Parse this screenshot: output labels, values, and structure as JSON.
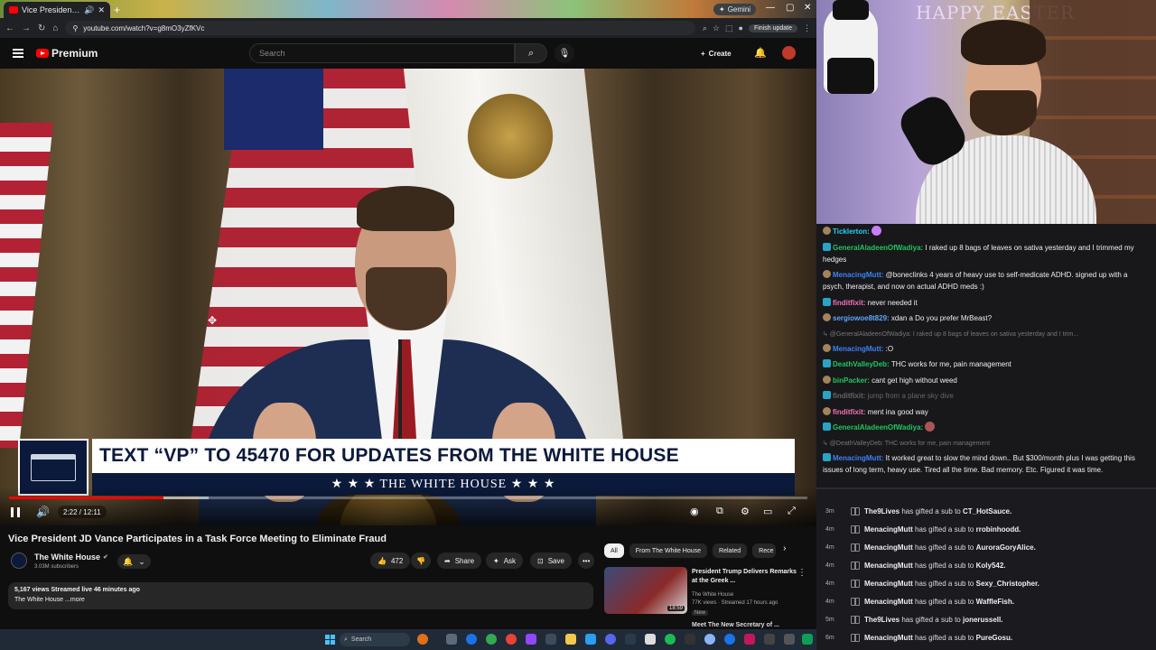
{
  "browser": {
    "tab_title": "Vice President JD Vance Pa",
    "new_tab": "+",
    "url": "youtube.com/watch?v=g8mO3yZfKVc",
    "gemini_label": "Gemini",
    "finish_update": "Finish update"
  },
  "yt_header": {
    "logo_text": "Premium",
    "search_placeholder": "Search",
    "create_label": "Create"
  },
  "video": {
    "lower_third_top": "TEXT “VP” TO 45470 FOR UPDATES FROM THE WHITE HOUSE",
    "lower_third_bottom": "★ ★ ★   THE WHITE HOUSE   ★ ★ ★",
    "time_display": "2:22 / 12:11",
    "progress_fraction": 0.194,
    "buffer_fraction": 0.25
  },
  "below_video": {
    "title": "Vice President JD Vance Participates in a Task Force Meeting to Eliminate Fraud",
    "channel_name": "The White House",
    "subscribers": "3.03M subscribers",
    "like_count": "472",
    "share_label": "Share",
    "ask_label": "Ask",
    "save_label": "Save",
    "description_line1": "5,167 views  Streamed live 46 minutes ago",
    "description_line2": "The White House ...more"
  },
  "recommendations": {
    "chips": [
      "All",
      "From The White House",
      "Related",
      "Rece"
    ],
    "item1": {
      "title": "President Trump Delivers Remarks at the Greek ...",
      "channel": "The White House",
      "meta": "77K views · Streamed 17 hours ago",
      "badge": "New",
      "duration": "18:59"
    },
    "item2_title": "Meet The New Secretary of ..."
  },
  "webcam": {
    "banner": "HAPPY EASTER"
  },
  "chat": {
    "messages": [
      {
        "user": "Ticklerton:",
        "text": "",
        "color": "#1fd1f9"
      },
      {
        "user": "GeneralAladeenOfWadiya:",
        "text": "I raked up 8 bags of leaves on sativa yesterday and I trimmed my hedges",
        "color": "#22c55e"
      },
      {
        "user": "MenacingMutt:",
        "text": "@bonecIinks 4 years of heavy use to self-medicate ADHD. signed up with a psych, therapist, and now on actual ADHD meds :)",
        "color": "#3b82f6"
      },
      {
        "user": "finditfixit:",
        "text": "never needed it",
        "color": "#f472b6"
      },
      {
        "user": "sergiowoe8t829:",
        "text": "xdan a Do you prefer MrBeast?",
        "color": "#60a5fa"
      },
      {
        "reply": "@GeneralAladeenOfWadiya: I raked up 8 bags of leaves on sativa yesterday and I trim..."
      },
      {
        "user": "MenacingMutt:",
        "text": ":O",
        "color": "#3b82f6"
      },
      {
        "user": "DeathValleyDeb:",
        "text": "THC works for me, pain management",
        "color": "#22c55e"
      },
      {
        "user": "binPacker:",
        "text": "cant get high without weed",
        "color": "#22c55e"
      },
      {
        "user": "finditfixit:",
        "text": "jump from a plane sky dive",
        "color": "#666",
        "dim": true
      },
      {
        "user": "finditfixit:",
        "text": "ment ina good way",
        "color": "#f472b6"
      },
      {
        "user": "GeneralAladeenOfWadiya:",
        "text": "",
        "color": "#22c55e"
      },
      {
        "reply": "@DeathValleyDeb: THC works for me, pain management"
      },
      {
        "user": "MenacingMutt:",
        "text": "It worked great to slow the mind down.. But $300/month plus I was getting this issues of long term, heavy use. Tired all the time. Bad memory. Etc. Figured it was time.",
        "color": "#3b82f6"
      }
    ]
  },
  "gifts": [
    {
      "time": "3m",
      "gifter": "The9Lives",
      "text": "has gifted a sub to",
      "recipient": "CT_HotSauce."
    },
    {
      "time": "4m",
      "gifter": "MenacingMutt",
      "text": "has gifted a sub to",
      "recipient": "rrobinhoodd."
    },
    {
      "time": "4m",
      "gifter": "MenacingMutt",
      "text": "has gifted a sub to",
      "recipient": "AuroraGoryAlice."
    },
    {
      "time": "4m",
      "gifter": "MenacingMutt",
      "text": "has gifted a sub to",
      "recipient": "Koly542."
    },
    {
      "time": "4m",
      "gifter": "MenacingMutt",
      "text": "has gifted a sub to",
      "recipient": "Sexy_Christopher."
    },
    {
      "time": "4m",
      "gifter": "MenacingMutt",
      "text": "has gifted a sub to",
      "recipient": "WaffleFish."
    },
    {
      "time": "5m",
      "gifter": "The9Lives",
      "text": "has gifted a sub to",
      "recipient": "jonerussell."
    },
    {
      "time": "6m",
      "gifter": "MenacingMutt",
      "text": "has gifted a sub to",
      "recipient": "PureGosu."
    }
  ],
  "taskbar": {
    "search_label": "Search"
  }
}
